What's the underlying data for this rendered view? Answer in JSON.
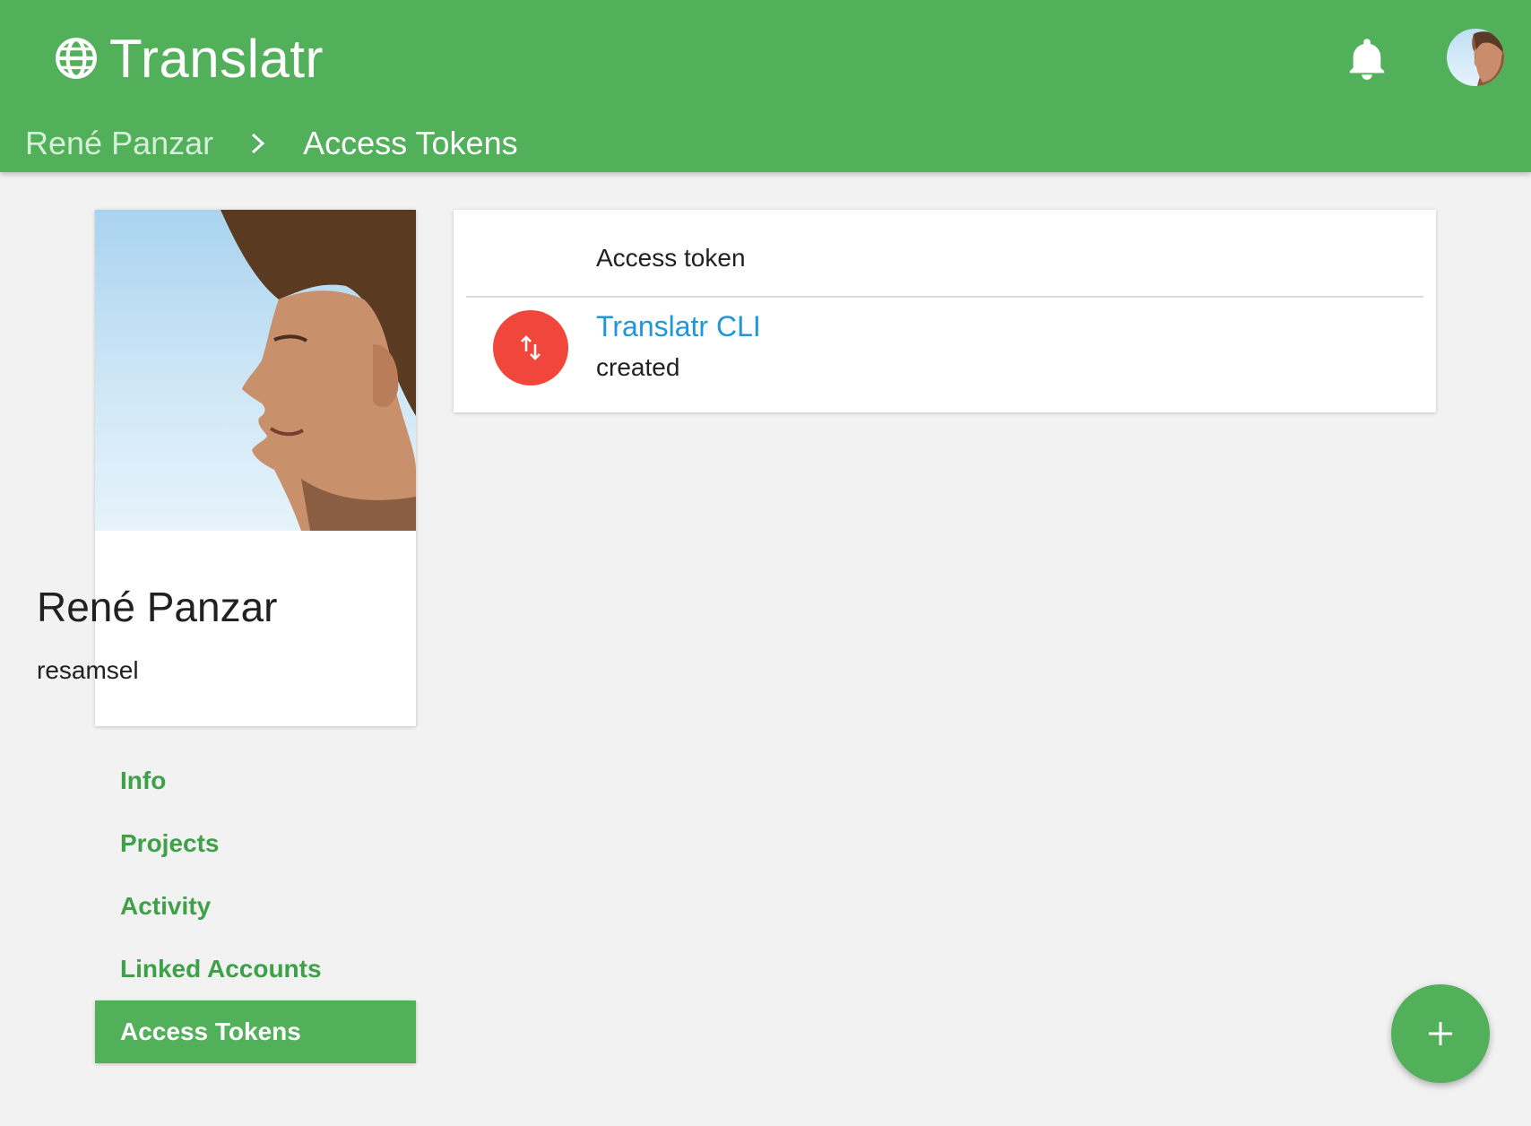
{
  "app": {
    "name": "Translatr",
    "brand_color": "#52b05a"
  },
  "header": {
    "icons": {
      "logo": "globe-icon",
      "notifications": "bell-icon",
      "avatar": "user-avatar"
    }
  },
  "breadcrumb": {
    "parent": "René Panzar",
    "current": "Access Tokens"
  },
  "profile": {
    "name": "René Panzar",
    "username": "resamsel"
  },
  "nav": {
    "items": [
      {
        "label": "Info",
        "active": false
      },
      {
        "label": "Projects",
        "active": false
      },
      {
        "label": "Activity",
        "active": false
      },
      {
        "label": "Linked Accounts",
        "active": false
      },
      {
        "label": "Access Tokens",
        "active": true
      }
    ]
  },
  "tokens": {
    "header": "Access token",
    "items": [
      {
        "name": "Translatr CLI",
        "status": "created",
        "icon": "swap-vert-icon",
        "icon_color": "#f0463c"
      }
    ]
  },
  "fab": {
    "icon": "plus-icon"
  }
}
